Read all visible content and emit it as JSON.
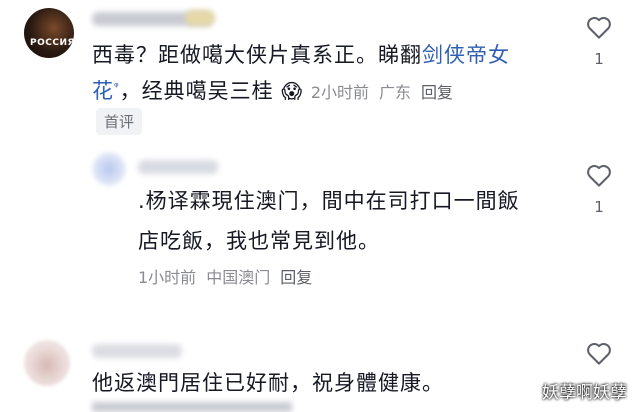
{
  "comment1": {
    "avatar_text": "РОССИЯ",
    "line1": "西毒？距做噶大侠片真系正。睇翻",
    "link_text": "剑侠帝女",
    "line2_link": "花",
    "line2_rest": "，经典噶吴三桂",
    "emoji": "😱",
    "time": "2小时前",
    "location": "广东",
    "reply": "回复",
    "tag": "首评",
    "like_count": "1"
  },
  "comment2": {
    "line1": ".杨译霖現住澳门，間中在司打口一間飯",
    "line2": "店吃飯，我也常見到他。",
    "time": "1小时前",
    "location": "中国澳门",
    "reply": "回复",
    "like_count": "1"
  },
  "comment3": {
    "line1": "他返澳門居住已好耐，祝身體健康。"
  },
  "watermark": "妖孽啊妖孽",
  "colors": {
    "link": "#2e5fb3",
    "meta": "#8a8b91",
    "text": "#161823"
  }
}
